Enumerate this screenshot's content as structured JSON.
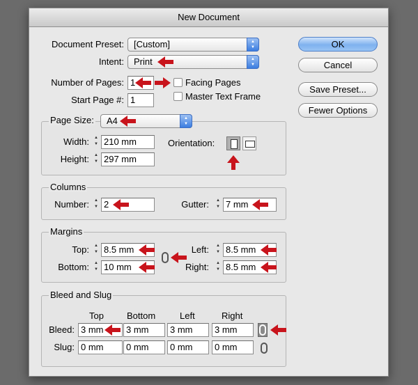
{
  "window": {
    "title": "New Document"
  },
  "document_preset": {
    "label": "Document Preset:",
    "value": "[Custom]"
  },
  "intent": {
    "label": "Intent:",
    "value": "Print"
  },
  "pages": {
    "number_label": "Number of Pages:",
    "number_value": "1",
    "start_label": "Start Page #:",
    "start_value": "1",
    "facing_pages_label": "Facing Pages",
    "facing_pages_checked": false,
    "master_text_frame_label": "Master Text Frame",
    "master_text_frame_checked": false
  },
  "buttons": {
    "ok": "OK",
    "cancel": "Cancel",
    "save_preset": "Save Preset...",
    "fewer_options": "Fewer Options"
  },
  "page_size": {
    "title": "Page Size:",
    "value": "A4",
    "width_label": "Width:",
    "width_value": "210 mm",
    "height_label": "Height:",
    "height_value": "297 mm",
    "orientation_label": "Orientation:",
    "orientation_selected": "portrait"
  },
  "columns": {
    "title": "Columns",
    "number_label": "Number:",
    "number_value": "2",
    "gutter_label": "Gutter:",
    "gutter_value": "7 mm"
  },
  "margins": {
    "title": "Margins",
    "top_label": "Top:",
    "top_value": "8.5 mm",
    "bottom_label": "Bottom:",
    "bottom_value": "10 mm",
    "left_label": "Left:",
    "left_value": "8.5 mm",
    "right_label": "Right:",
    "right_value": "8.5 mm"
  },
  "bleed_slug": {
    "title": "Bleed and Slug",
    "col_top": "Top",
    "col_bottom": "Bottom",
    "col_left": "Left",
    "col_right": "Right",
    "bleed_label": "Bleed:",
    "bleed": {
      "top": "3 mm",
      "bottom": "3 mm",
      "left": "3 mm",
      "right": "3 mm"
    },
    "slug_label": "Slug:",
    "slug": {
      "top": "0 mm",
      "bottom": "0 mm",
      "left": "0 mm",
      "right": "0 mm"
    }
  },
  "colors": {
    "accent": "#3b7de0",
    "annotation_arrow": "#c8141c"
  }
}
